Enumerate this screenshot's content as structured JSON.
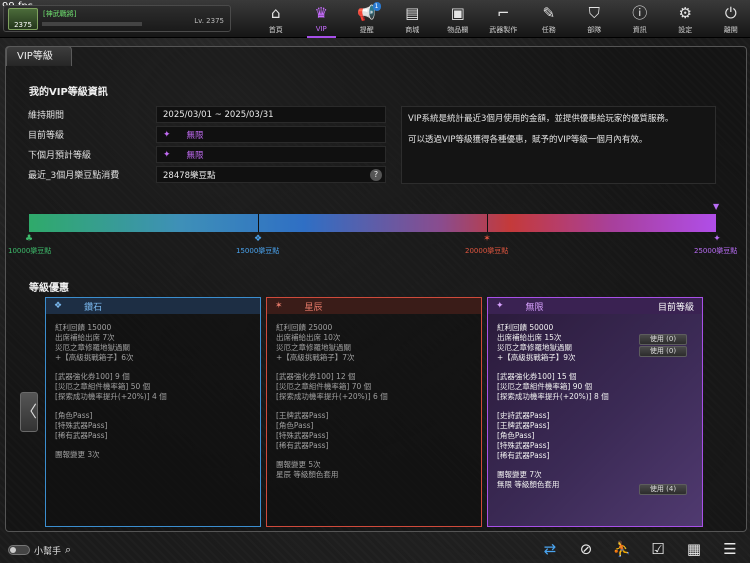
{
  "fps": "99 fps",
  "player": {
    "tag": "[神武戰將]",
    "rank_number": "2375",
    "level_text": "Lv. 2375"
  },
  "nav": [
    {
      "label": "首頁",
      "icon": "home-icon"
    },
    {
      "label": "VIP",
      "icon": "crown-icon"
    },
    {
      "label": "提醒",
      "icon": "megaphone-icon",
      "badge": "1"
    },
    {
      "label": "商城",
      "icon": "shop-icon"
    },
    {
      "label": "物品欄",
      "icon": "bag-icon"
    },
    {
      "label": "武器製作",
      "icon": "gun-icon"
    },
    {
      "label": "任務",
      "icon": "ticket-icon"
    },
    {
      "label": "部隊",
      "icon": "shield-icon"
    },
    {
      "label": "資訊",
      "icon": "info-icon"
    },
    {
      "label": "設定",
      "icon": "gear-icon"
    },
    {
      "label": "離開",
      "icon": "power-icon"
    }
  ],
  "panel": {
    "tab": "VIP等級",
    "info_title": "我的VIP等級資訊",
    "rows": {
      "period": {
        "label": "維持期間",
        "value": "2025/03/01 ~ 2025/03/31"
      },
      "current": {
        "label": "目前等級",
        "value": "無限"
      },
      "next": {
        "label": "下個月預計等級",
        "value": "無限"
      },
      "spend": {
        "label": "最近_3個月樂豆點消費",
        "value": "28478樂豆點"
      }
    },
    "description": [
      "VIP系統是統計最近3個月使用的金額，並提供優惠給玩家的優質服務。",
      "可以透過VIP等級獲得各種優惠，賦予的VIP等級一個月內有效。"
    ]
  },
  "progress": {
    "fill_fraction": 1.0,
    "markers": [
      {
        "label": "10000樂豆點",
        "color": "#3dbb6b"
      },
      {
        "label": "15000樂豆點",
        "color": "#4aa3ee"
      },
      {
        "label": "20000樂豆點",
        "color": "#e0553f"
      },
      {
        "label": "25000樂豆點",
        "color": "#b86cf4"
      }
    ]
  },
  "benefits_title": "等級優惠",
  "cards": {
    "diamond": {
      "name": "鑽石",
      "lines": [
        "紅利回饋 15000",
        "出席補給出席 7次",
        "災厄之章修羅地獄過關",
        "+【高級挑戰箱子】6次",
        "[武器強化券100] 9 個",
        "[災厄之章組件機率箱] 50 個",
        "[探索成功機率提升(+20%)] 4 個",
        "[角色Pass]",
        "[特殊武器Pass]",
        "[稀有武器Pass]",
        "團報變更 3次"
      ]
    },
    "star": {
      "name": "星辰",
      "lines": [
        "紅利回饋 25000",
        "出席補給出席 10次",
        "災厄之章修羅地獄過關",
        "+【高級挑戰箱子】7次",
        "[武器強化券100] 12 個",
        "[災厄之章組件機率箱] 70 個",
        "[探索成功機率提升(+20%)] 6 個",
        "[王牌武器Pass]",
        "[角色Pass]",
        "[特殊武器Pass]",
        "[稀有武器Pass]",
        "團報變更 5次",
        "星辰 等級顏色套用"
      ]
    },
    "infinite": {
      "name": "無限",
      "current_label": "目前等級",
      "lines": [
        "紅利回饋 50000",
        "出席補給出席 15次",
        "災厄之章修羅地獄過關",
        "+【高級挑戰箱子】9次",
        "[武器強化券100] 15 個",
        "[災厄之章組件機率箱] 90 個",
        "[探索成功機率提升(+20%)] 8 個",
        "[史詩武器Pass]",
        "[王牌武器Pass]",
        "[角色Pass]",
        "[特殊武器Pass]",
        "[稀有武器Pass]",
        "團報變更 7次",
        "無限 等級顏色套用"
      ],
      "use_buttons": [
        "使用 (0)",
        "使用 (0)",
        "使用 (4)"
      ]
    }
  },
  "helper": {
    "label": "小幫手"
  },
  "bottom_icons": [
    "swap-icon",
    "compass-icon",
    "runner-icon",
    "checklist-icon",
    "calendar-icon",
    "menu-icon"
  ]
}
